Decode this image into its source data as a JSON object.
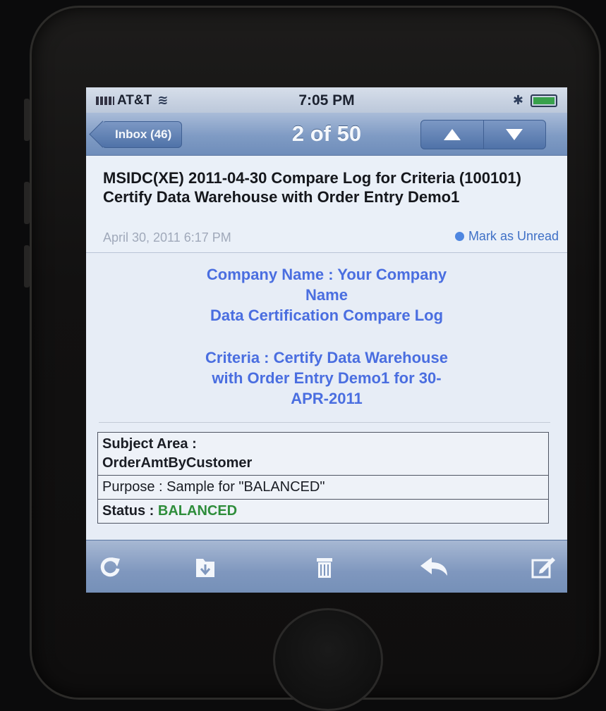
{
  "status_bar": {
    "carrier": "AT&T",
    "time": "7:05 PM"
  },
  "nav": {
    "back_label": "Inbox (46)",
    "position": "2 of 50"
  },
  "message": {
    "subject": "MSIDC(XE) 2011-04-30 Compare Log for Criteria (100101) Certify Data Warehouse with Order Entry Demo1",
    "date": "April 30, 2011 6:17 PM",
    "mark_unread_label": "Mark as Unread"
  },
  "body": {
    "company_line1": "Company Name : Your Company",
    "company_line2": "Name",
    "log_title": "Data Certification Compare Log",
    "criteria_line1": "Criteria : Certify Data Warehouse",
    "criteria_line2": "with Order Entry Demo1 for 30-",
    "criteria_line3": "APR-2011",
    "table": {
      "subject_area_label": "Subject Area :",
      "subject_area_value": "OrderAmtByCustomer",
      "purpose": "Purpose : Sample for \"BALANCED\"",
      "status_label": "Status : ",
      "status_value": "BALANCED"
    }
  },
  "toolbar": {
    "icons": [
      "refresh-icon",
      "move-to-folder-icon",
      "trash-icon",
      "reply-icon",
      "compose-icon"
    ]
  },
  "colors": {
    "nav_blue": "#7f9bc4",
    "heading_blue": "#4a6ee0",
    "status_green": "#2e8d3b"
  }
}
